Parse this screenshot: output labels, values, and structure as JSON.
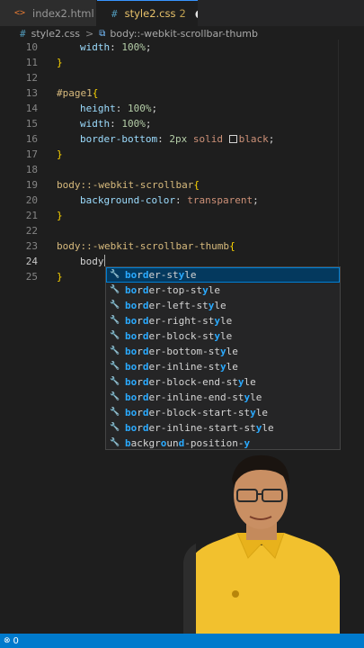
{
  "tabs": [
    {
      "icon": "<>",
      "label": "index2.html",
      "active": false
    },
    {
      "icon": "#",
      "label": "style2.css",
      "badge": "2",
      "dirty_marker": "●",
      "active": true
    }
  ],
  "breadcrumb": {
    "file_icon": "#",
    "file": "style2.css",
    "separator": ">",
    "symbol_icon": "⧉",
    "symbol": "body::-webkit-scrollbar-thumb"
  },
  "editor": {
    "lines": [
      {
        "n": "10",
        "indent": 1,
        "tokens": [
          {
            "t": "width",
            "c": "prop"
          },
          {
            "t": ": ",
            "c": "punc"
          },
          {
            "t": "100%",
            "c": "num"
          },
          {
            "t": ";",
            "c": "punc"
          }
        ]
      },
      {
        "n": "11",
        "indent": 0,
        "tokens": [
          {
            "t": "}",
            "c": "brace"
          }
        ]
      },
      {
        "n": "12",
        "indent": 0,
        "tokens": []
      },
      {
        "n": "13",
        "indent": 0,
        "tokens": [
          {
            "t": "#page1",
            "c": "sel"
          },
          {
            "t": "{",
            "c": "brace"
          }
        ]
      },
      {
        "n": "14",
        "indent": 1,
        "tokens": [
          {
            "t": "height",
            "c": "prop"
          },
          {
            "t": ": ",
            "c": "punc"
          },
          {
            "t": "100%",
            "c": "num"
          },
          {
            "t": ";",
            "c": "punc"
          }
        ]
      },
      {
        "n": "15",
        "indent": 1,
        "tokens": [
          {
            "t": "width",
            "c": "prop"
          },
          {
            "t": ": ",
            "c": "punc"
          },
          {
            "t": "100%",
            "c": "num"
          },
          {
            "t": ";",
            "c": "punc"
          }
        ]
      },
      {
        "n": "16",
        "indent": 1,
        "tokens": [
          {
            "t": "border-bottom",
            "c": "prop"
          },
          {
            "t": ": ",
            "c": "punc"
          },
          {
            "t": "2px",
            "c": "num"
          },
          {
            "t": " ",
            "c": "punc"
          },
          {
            "t": "solid",
            "c": "val"
          },
          {
            "t": " ",
            "c": "punc"
          },
          {
            "t": "",
            "c": "swatch"
          },
          {
            "t": "black",
            "c": "val"
          },
          {
            "t": ";",
            "c": "punc"
          }
        ]
      },
      {
        "n": "17",
        "indent": 0,
        "tokens": [
          {
            "t": "}",
            "c": "brace"
          }
        ]
      },
      {
        "n": "18",
        "indent": 0,
        "tokens": []
      },
      {
        "n": "19",
        "indent": 0,
        "tokens": [
          {
            "t": "body::-webkit-scrollbar",
            "c": "sel"
          },
          {
            "t": "{",
            "c": "brace"
          }
        ]
      },
      {
        "n": "20",
        "indent": 1,
        "tokens": [
          {
            "t": "background-color",
            "c": "prop"
          },
          {
            "t": ": ",
            "c": "punc"
          },
          {
            "t": "transparent",
            "c": "val"
          },
          {
            "t": ";",
            "c": "punc"
          }
        ]
      },
      {
        "n": "21",
        "indent": 0,
        "tokens": [
          {
            "t": "}",
            "c": "brace"
          }
        ]
      },
      {
        "n": "22",
        "indent": 0,
        "tokens": []
      },
      {
        "n": "23",
        "indent": 0,
        "tokens": [
          {
            "t": "body::-webkit-scrollbar-thumb",
            "c": "sel"
          },
          {
            "t": "{",
            "c": "brace"
          }
        ]
      },
      {
        "n": "24",
        "indent": 1,
        "current": true,
        "tokens": [
          {
            "t": "body",
            "c": "punc"
          },
          {
            "t": "",
            "c": "cursor"
          }
        ]
      },
      {
        "n": "25",
        "indent": 0,
        "tokens": [
          {
            "t": "}",
            "c": "brace"
          }
        ]
      }
    ]
  },
  "suggestions": [
    {
      "label": "border-style",
      "match": "bor|d|er-st|y|le",
      "focused": true
    },
    {
      "label": "border-top-style"
    },
    {
      "label": "border-left-style"
    },
    {
      "label": "border-right-style"
    },
    {
      "label": "border-block-style"
    },
    {
      "label": "border-bottom-style"
    },
    {
      "label": "border-inline-style"
    },
    {
      "label": "border-block-end-style"
    },
    {
      "label": "border-inline-end-style"
    },
    {
      "label": "border-block-start-style"
    },
    {
      "label": "border-inline-start-style"
    },
    {
      "label": "background-position-y"
    }
  ],
  "suggestion_icon": "wrench-icon",
  "status": {
    "error_icon": "⊗",
    "count": "0"
  },
  "colors": {
    "accent": "#007acc",
    "selector": "#d7ba7d",
    "property": "#9cdcfe",
    "number": "#b5cea8",
    "string": "#ce9178",
    "match": "#2aaaff"
  }
}
